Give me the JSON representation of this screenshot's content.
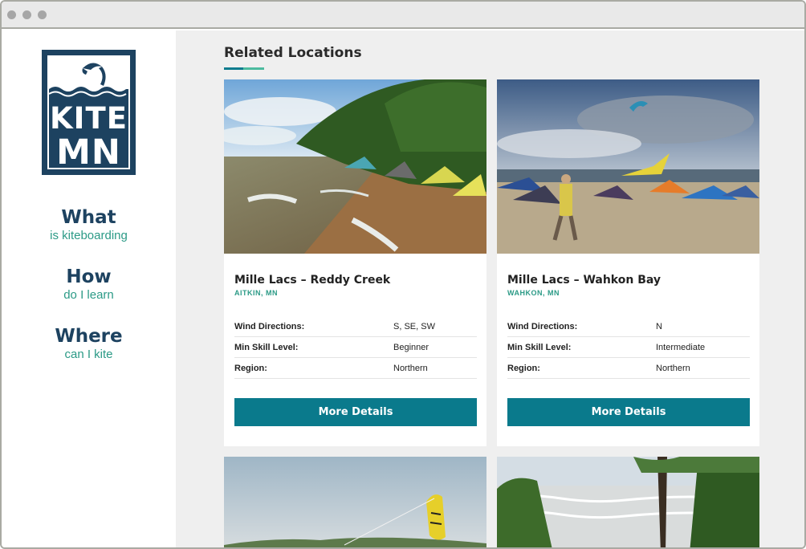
{
  "window": {
    "controls": [
      "close",
      "minimize",
      "maximize"
    ]
  },
  "logo": {
    "line1": "KITE",
    "line2": "MN",
    "icon": "kite-wave-icon"
  },
  "nav": [
    {
      "title": "What",
      "subtitle": "is kiteboarding"
    },
    {
      "title": "How",
      "subtitle": "do I learn"
    },
    {
      "title": "Where",
      "subtitle": "can I kite"
    }
  ],
  "section": {
    "title": "Related Locations"
  },
  "colors": {
    "brand_navy": "#1d4260",
    "accent_teal": "#0a7a8c",
    "accent_green": "#2b9a86",
    "background": "#efefef"
  },
  "cards": [
    {
      "title": "Mille Lacs – Reddy Creek",
      "location": "AITKIN, MN",
      "rows": [
        {
          "label": "Wind Directions:",
          "value": "S, SE, SW"
        },
        {
          "label": "Min Skill Level:",
          "value": "Beginner"
        },
        {
          "label": "Region:",
          "value": "Northern"
        }
      ],
      "button": "More Details",
      "photo": "beach-with-kites-photo"
    },
    {
      "title": "Mille Lacs – Wahkon Bay",
      "location": "WAHKON, MN",
      "rows": [
        {
          "label": "Wind Directions:",
          "value": "N"
        },
        {
          "label": "Min Skill Level:",
          "value": "Intermediate"
        },
        {
          "label": "Region:",
          "value": "Northern"
        }
      ],
      "button": "More Details",
      "photo": "kiteboarders-on-beach-photo"
    },
    {
      "photo": "yellow-kite-sky-photo"
    },
    {
      "photo": "lake-through-trees-photo"
    }
  ]
}
